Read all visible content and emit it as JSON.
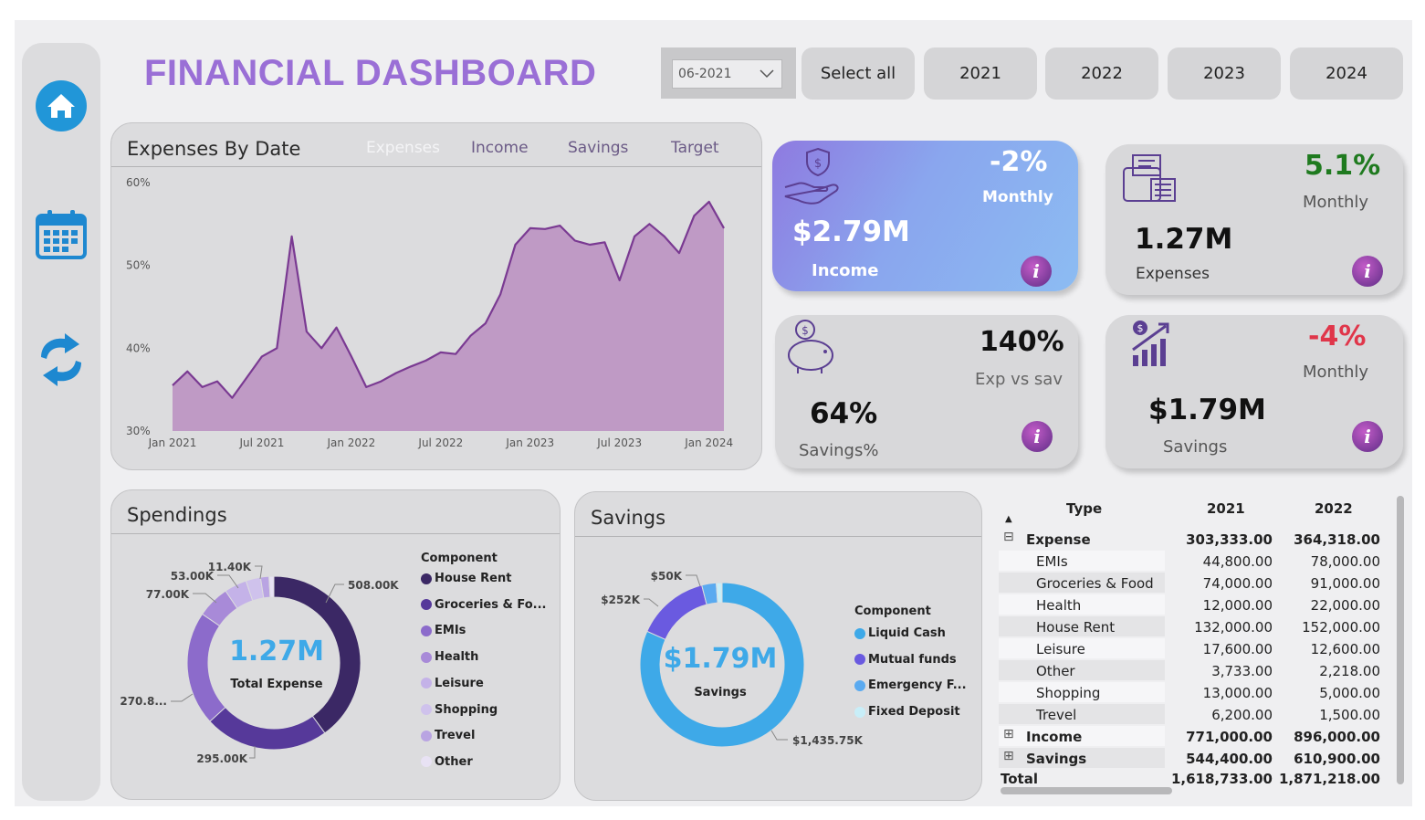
{
  "title": "FINANCIAL DASHBOARD",
  "slicer": {
    "value": "06-2021"
  },
  "year_buttons": [
    "Select all",
    "2021",
    "2022",
    "2023",
    "2024"
  ],
  "expenses_chart": {
    "title": "Expenses By Date",
    "tabs": [
      "Expenses",
      "Income",
      "Savings",
      "Target"
    ],
    "y_ticks": [
      "60%",
      "50%",
      "40%",
      "30%"
    ],
    "x_ticks": [
      "Jan 2021",
      "Jul 2021",
      "Jan 2022",
      "Jul 2022",
      "Jan 2023",
      "Jul 2023",
      "Jan 2024"
    ]
  },
  "kpis": {
    "income": {
      "value": "$2.79M",
      "label": "Income",
      "pct": "-2%",
      "pct_label": "Monthly"
    },
    "expenses": {
      "value": "1.27M",
      "label": "Expenses",
      "pct": "5.1%",
      "pct_label": "Monthly"
    },
    "savings_pct": {
      "value": "64%",
      "label": "Savings%",
      "pct": "140%",
      "pct_label": "Exp vs sav"
    },
    "savings": {
      "value": "$1.79M",
      "label": "Savings",
      "pct": "-4%",
      "pct_label": "Monthly"
    },
    "info": "i"
  },
  "spendings": {
    "title": "Spendings",
    "center_value": "1.27M",
    "center_label": "Total Expense",
    "legend_title": "Component",
    "legend": [
      "House Rent",
      "Groceries & Fo...",
      "EMIs",
      "Health",
      "Leisure",
      "Shopping",
      "Trevel",
      "Other"
    ],
    "labels": [
      "508.00K",
      "295.00K",
      "270.8...",
      "77.00K",
      "53.00K",
      "11.40K"
    ]
  },
  "savings_donut": {
    "title": "Savings",
    "center_value": "$1.79M",
    "center_label": "Savings",
    "legend_title": "Component",
    "legend": [
      "Liquid Cash",
      "Mutual funds",
      "Emergency F...",
      "Fixed Deposit"
    ],
    "labels": [
      "$1,435.75K",
      "$252K",
      "$50K"
    ]
  },
  "matrix": {
    "headers": [
      "Type",
      "2021",
      "2022"
    ],
    "rows": [
      {
        "label": "Expense",
        "v1": "303,333.00",
        "v2": "364,318.00",
        "level": 0,
        "toggle": "⊟"
      },
      {
        "label": "EMIs",
        "v1": "44,800.00",
        "v2": "78,000.00",
        "level": 1
      },
      {
        "label": "Groceries & Food",
        "v1": "74,000.00",
        "v2": "91,000.00",
        "level": 1
      },
      {
        "label": "Health",
        "v1": "12,000.00",
        "v2": "22,000.00",
        "level": 1
      },
      {
        "label": "House Rent",
        "v1": "132,000.00",
        "v2": "152,000.00",
        "level": 1
      },
      {
        "label": "Leisure",
        "v1": "17,600.00",
        "v2": "12,600.00",
        "level": 1
      },
      {
        "label": "Other",
        "v1": "3,733.00",
        "v2": "2,218.00",
        "level": 1
      },
      {
        "label": "Shopping",
        "v1": "13,000.00",
        "v2": "5,000.00",
        "level": 1
      },
      {
        "label": "Trevel",
        "v1": "6,200.00",
        "v2": "1,500.00",
        "level": 1
      },
      {
        "label": "Income",
        "v1": "771,000.00",
        "v2": "896,000.00",
        "level": 0,
        "toggle": "⊞"
      },
      {
        "label": "Savings",
        "v1": "544,400.00",
        "v2": "610,900.00",
        "level": 0,
        "toggle": "⊞"
      },
      {
        "label": "Total",
        "v1": "1,618,733.00",
        "v2": "1,871,218.00",
        "level": 0
      }
    ]
  },
  "chart_data": [
    {
      "type": "area",
      "title": "Expenses By Date",
      "ylim": [
        30,
        60
      ],
      "y_unit": "%",
      "x": [
        "2021-01",
        "2021-02",
        "2021-03",
        "2021-04",
        "2021-05",
        "2021-06",
        "2021-07",
        "2021-08",
        "2021-09",
        "2021-10",
        "2021-11",
        "2021-12",
        "2022-01",
        "2022-02",
        "2022-03",
        "2022-04",
        "2022-05",
        "2022-06",
        "2022-07",
        "2022-08",
        "2022-09",
        "2022-10",
        "2022-11",
        "2022-12",
        "2023-01",
        "2023-02",
        "2023-03",
        "2023-04",
        "2023-05",
        "2023-06",
        "2023-07",
        "2023-08",
        "2023-09",
        "2023-10",
        "2023-11",
        "2023-12",
        "2024-01",
        "2024-02"
      ],
      "values": [
        35.5,
        37.2,
        35.3,
        36.0,
        34.0,
        36.5,
        39.0,
        40.0,
        53.5,
        42.0,
        40.0,
        42.5,
        39.0,
        35.3,
        36.0,
        37.0,
        37.8,
        38.5,
        39.5,
        39.3,
        41.5,
        43.0,
        46.5,
        52.5,
        54.5,
        54.4,
        54.8,
        53.0,
        52.5,
        52.8,
        48.2,
        53.5,
        55.0,
        53.5,
        51.5,
        56.0,
        57.7,
        54.5
      ]
    },
    {
      "type": "pie",
      "title": "Spendings",
      "categories": [
        "House Rent",
        "Groceries & Food",
        "EMIs",
        "Health",
        "Leisure",
        "Shopping",
        "Trevel",
        "Other"
      ],
      "values": [
        508.0,
        295.0,
        270.8,
        77.0,
        53.0,
        35.0,
        20.0,
        11.4
      ],
      "unit": "K",
      "colors": [
        "#3b2865",
        "#56399a",
        "#8c6bcb",
        "#a88ad8",
        "#c4b2e8",
        "#cfc2ec",
        "#b9a4e2",
        "#e8e2f4"
      ]
    },
    {
      "type": "pie",
      "title": "Savings",
      "categories": [
        "Liquid Cash",
        "Mutual funds",
        "Emergency Fund",
        "Fixed Deposit"
      ],
      "values": [
        1435.75,
        252,
        50,
        20
      ],
      "unit": "K",
      "colors": [
        "#3ea9e8",
        "#6a5ae0",
        "#5aaaf0",
        "#c8eef8"
      ]
    }
  ],
  "colors": {
    "accent": "#9a6fd6",
    "area_fill": "#bf9ac5",
    "area_line": "#7a3a92",
    "positive": "#1f7a1f",
    "negative": "#e0364a",
    "icon_blue": "#1e88d0"
  }
}
